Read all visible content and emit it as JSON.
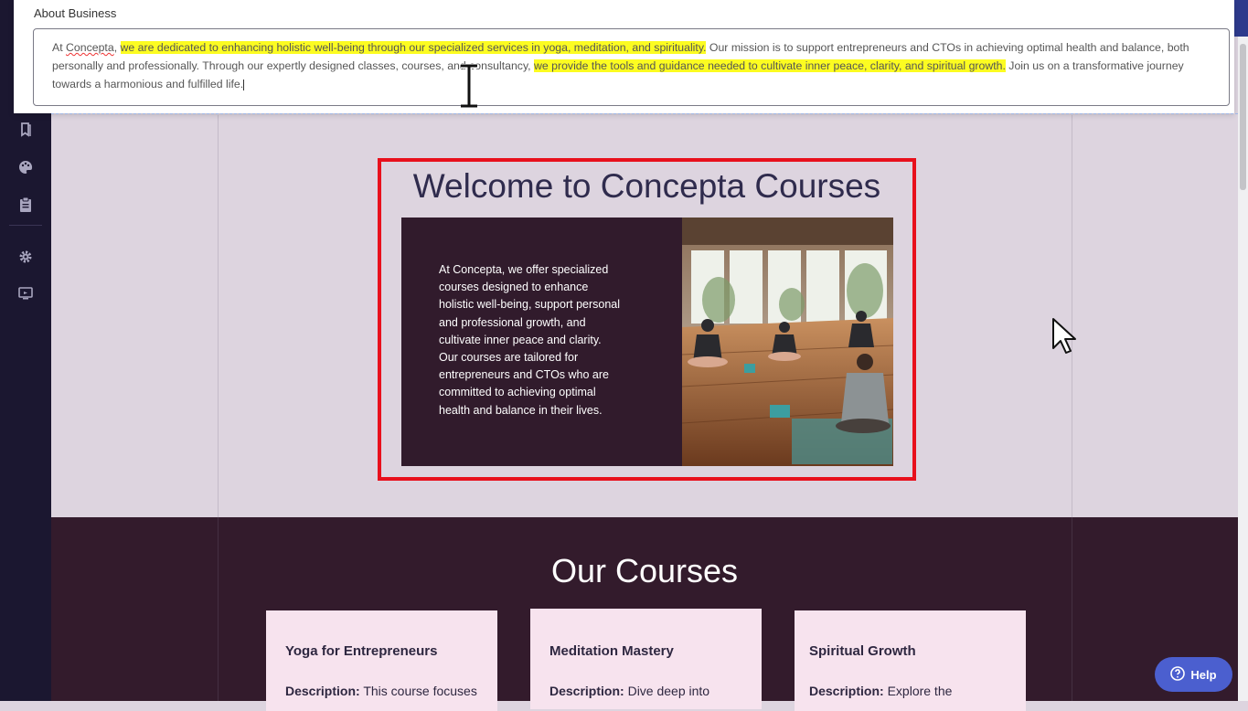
{
  "popup": {
    "title": "About Business",
    "text_plain_1": "At ",
    "text_misspelled": "Concepta",
    "text_plain_2": ", ",
    "text_highlight_1": "we are dedicated to enhancing holistic well-being through our specialized services in yoga, meditation, and spirituality.",
    "text_plain_3": " Our mission is to support entrepreneurs and CTOs in achieving optimal health and balance, both personally and professionally. Through our expertly designed classes, courses, and consultancy, ",
    "text_highlight_2": "we provide the tools and guidance needed to cultivate inner peace, clarity, and spiritual growth.",
    "text_plain_4": " Join us on a transformative journey towards a harmonious and fulfilled life."
  },
  "sidebar": {
    "icons": [
      "bookmark-icon",
      "palette-icon",
      "clipboard-icon",
      "gear-icon",
      "monitor-icon"
    ]
  },
  "hero": {
    "title": "Welcome to Concepta Courses",
    "body": "At Concepta, we offer specialized courses designed to enhance holistic well-being, support personal and professional growth, and cultivate inner peace and clarity. Our courses are tailored for entrepreneurs and CTOs who are committed to achieving optimal health and balance in their lives."
  },
  "courses": {
    "title": "Our Courses",
    "description_label": "Description:",
    "items": [
      {
        "title": "Yoga for Entrepreneurs",
        "desc": "This course focuses"
      },
      {
        "title": "Meditation Mastery",
        "desc": "Dive deep into"
      },
      {
        "title": "Spiritual Growth",
        "desc": "Explore the"
      }
    ]
  },
  "help": {
    "label": "Help"
  },
  "colors": {
    "accent": "#4b5fcf",
    "highlight": "#fcfc21",
    "selection_border": "#e8101c",
    "dark_panel": "#311b2c",
    "sidebar": "#1b1730"
  }
}
